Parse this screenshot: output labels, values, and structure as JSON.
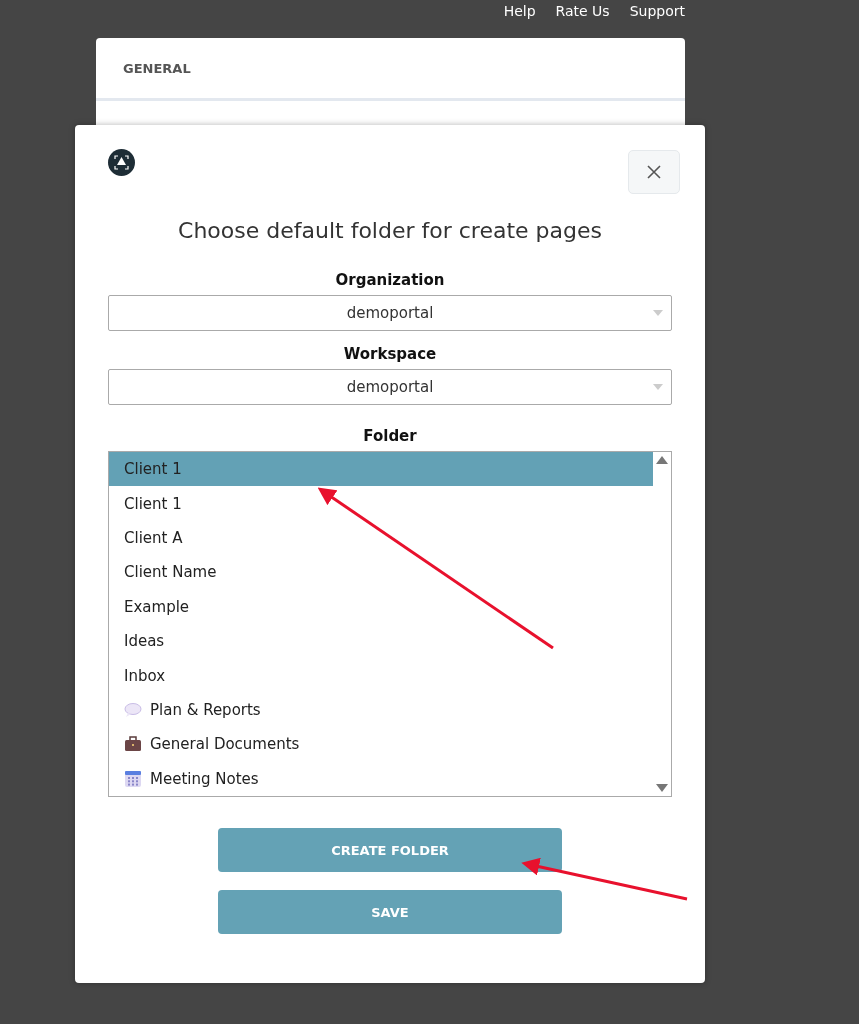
{
  "top_links": [
    "Help",
    "Rate Us",
    "Support"
  ],
  "background_card": {
    "heading": "GENERAL"
  },
  "dialog": {
    "title": "Choose default folder for create pages",
    "fields": [
      {
        "label": "Organization",
        "value": "demoportal"
      },
      {
        "label": "Workspace",
        "value": "demoportal"
      }
    ],
    "folder": {
      "label": "Folder",
      "items": [
        {
          "label": "Client 1",
          "kind": "plain",
          "selected": true
        },
        {
          "label": "Client 1",
          "kind": "plain",
          "selected": false
        },
        {
          "label": "Client A",
          "kind": "plain",
          "selected": false
        },
        {
          "label": "Client Name",
          "kind": "plain",
          "selected": false
        },
        {
          "label": "Example",
          "kind": "plain",
          "selected": false
        },
        {
          "label": "Ideas",
          "kind": "plain",
          "selected": false
        },
        {
          "label": "Inbox",
          "kind": "plain",
          "selected": false
        },
        {
          "label": "Plan & Reports",
          "kind": "speech",
          "selected": false
        },
        {
          "label": "General Documents",
          "kind": "briefcase",
          "selected": false
        },
        {
          "label": "Meeting Notes",
          "kind": "calendar",
          "selected": false
        }
      ]
    },
    "buttons": [
      "CREATE FOLDER",
      "SAVE"
    ]
  }
}
